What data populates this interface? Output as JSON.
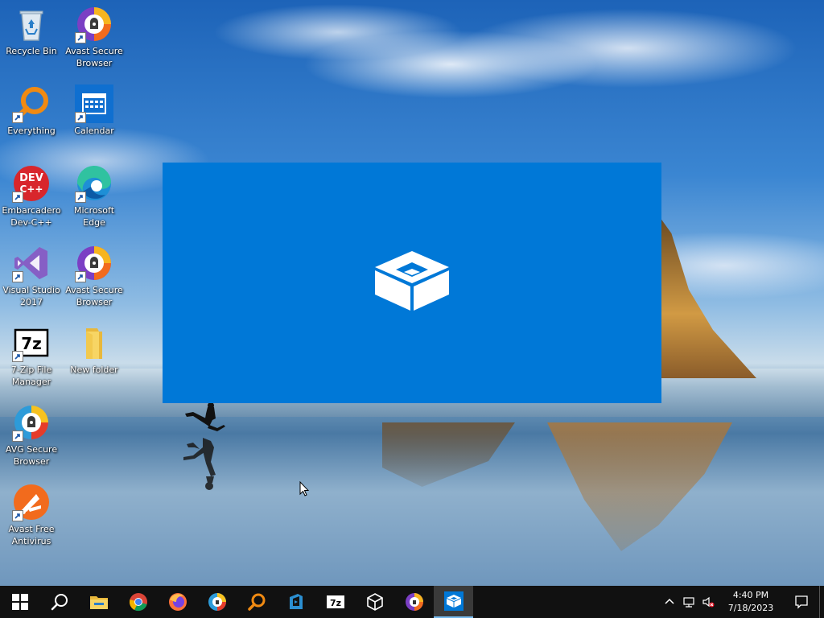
{
  "desktop": {
    "icons": [
      {
        "label": "Recycle Bin",
        "icon": "recycle-bin-icon"
      },
      {
        "label": "Avast Secure Browser",
        "icon": "avast-secure-browser-icon"
      },
      {
        "label": "Everything",
        "icon": "everything-search-icon"
      },
      {
        "label": "Calendar",
        "icon": "calendar-icon"
      },
      {
        "label": "Embarcadero Dev-C++",
        "icon": "devcpp-icon"
      },
      {
        "label": "Microsoft Edge",
        "icon": "edge-icon"
      },
      {
        "label": "Visual Studio 2017",
        "icon": "visual-studio-icon"
      },
      {
        "label": "Avast Secure Browser",
        "icon": "avast-secure-browser-icon"
      },
      {
        "label": "7-Zip File Manager",
        "icon": "7zip-icon"
      },
      {
        "label": "New folder",
        "icon": "folder-icon"
      },
      {
        "label": "AVG Secure Browser",
        "icon": "avg-secure-browser-icon"
      },
      {
        "label": "Avast Free Antivirus",
        "icon": "avast-antivirus-icon"
      }
    ],
    "devcpp_badge_text": "DEV C++",
    "sevenzip_badge_text": "7z"
  },
  "splash": {
    "icon": "sandbox-box-icon",
    "color": "#0078d7"
  },
  "taskbar": {
    "apps": [
      {
        "icon": "start-windows-icon"
      },
      {
        "icon": "search-icon"
      },
      {
        "icon": "file-explorer-icon"
      },
      {
        "icon": "chrome-icon"
      },
      {
        "icon": "firefox-icon"
      },
      {
        "icon": "avast-browser-icon"
      },
      {
        "icon": "everything-search-icon"
      },
      {
        "icon": "visual-studio-installer-icon"
      },
      {
        "icon": "7zip-icon"
      },
      {
        "icon": "sandbox-cube-icon"
      },
      {
        "icon": "avast-secure-browser-icon"
      },
      {
        "icon": "windows-sandbox-icon",
        "active": true
      }
    ],
    "sevenzip_text": "7z",
    "tray": {
      "icons": [
        "chevron-up-icon",
        "network-icon",
        "volume-muted-icon"
      ],
      "time": "4:40 PM",
      "date": "7/18/2023",
      "notification_icon": "action-center-icon"
    }
  }
}
